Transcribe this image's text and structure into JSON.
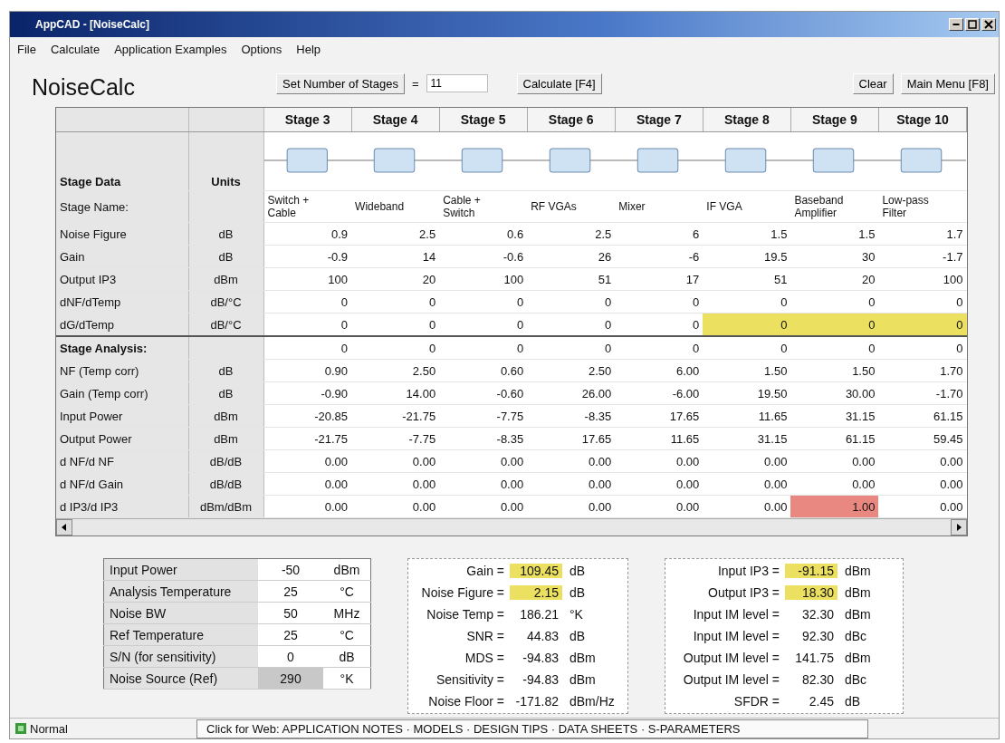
{
  "window": {
    "title": "AppCAD - [NoiseCalc]"
  },
  "menu": [
    "File",
    "Calculate",
    "Application Examples",
    "Options",
    "Help"
  ],
  "app_title": "NoiseCalc",
  "toolbar": {
    "set_stages_button": "Set Number of Stages",
    "equals": "=",
    "stages_value": "11",
    "calculate_button": "Calculate [F4]",
    "clear_button": "Clear",
    "main_menu_button": "Main Menu [F8]"
  },
  "stage_table": {
    "data_heading": "Stage Data",
    "units_heading": "Units",
    "name_label": "Stage Name:",
    "stages": [
      {
        "header": "Stage 3",
        "name": "Switch + Cable"
      },
      {
        "header": "Stage 4",
        "name": "Wideband"
      },
      {
        "header": "Stage 5",
        "name": "Cable + Switch"
      },
      {
        "header": "Stage 6",
        "name": "RF VGAs"
      },
      {
        "header": "Stage 7",
        "name": "Mixer"
      },
      {
        "header": "Stage 8",
        "name": "IF VGA"
      },
      {
        "header": "Stage 9",
        "name": "Baseband Amplifier"
      },
      {
        "header": "Stage 10",
        "name": "Low-pass Filter"
      }
    ],
    "data_rows": [
      {
        "label": "Noise Figure",
        "unit": "dB",
        "cells": [
          {
            "text": "0.9"
          },
          {
            "text": "2.5"
          },
          {
            "text": "0.6"
          },
          {
            "text": "2.5"
          },
          {
            "text": "6"
          },
          {
            "text": "1.5"
          },
          {
            "text": "1.5"
          },
          {
            "text": "1.7"
          }
        ]
      },
      {
        "label": "Gain",
        "unit": "dB",
        "cells": [
          {
            "text": "-0.9"
          },
          {
            "text": "14"
          },
          {
            "text": "-0.6"
          },
          {
            "text": "26"
          },
          {
            "text": "-6"
          },
          {
            "text": "19.5"
          },
          {
            "text": "30"
          },
          {
            "text": "-1.7"
          }
        ]
      },
      {
        "label": "Output IP3",
        "unit": "dBm",
        "cells": [
          {
            "text": "100"
          },
          {
            "text": "20"
          },
          {
            "text": "100"
          },
          {
            "text": "51"
          },
          {
            "text": "17"
          },
          {
            "text": "51"
          },
          {
            "text": "20"
          },
          {
            "text": "100"
          }
        ]
      },
      {
        "label": "dNF/dTemp",
        "unit": "dB/°C",
        "cells": [
          {
            "text": "0"
          },
          {
            "text": "0"
          },
          {
            "text": "0"
          },
          {
            "text": "0"
          },
          {
            "text": "0"
          },
          {
            "text": "0"
          },
          {
            "text": "0"
          },
          {
            "text": "0"
          }
        ]
      },
      {
        "label": "dG/dTemp",
        "unit": "dB/°C",
        "cells": [
          {
            "text": "0"
          },
          {
            "text": "0"
          },
          {
            "text": "0"
          },
          {
            "text": "0"
          },
          {
            "text": "0"
          },
          {
            "text": "0",
            "color": "#ece060"
          },
          {
            "text": "0",
            "color": "#ece060"
          },
          {
            "text": "0",
            "color": "#ece060"
          }
        ]
      }
    ],
    "analysis_heading": "Stage Analysis:",
    "analysis_heading_cells": [
      {
        "text": "0"
      },
      {
        "text": "0"
      },
      {
        "text": "0"
      },
      {
        "text": "0"
      },
      {
        "text": "0"
      },
      {
        "text": "0"
      },
      {
        "text": "0"
      },
      {
        "text": "0"
      }
    ],
    "analysis_rows": [
      {
        "label": "NF (Temp corr)",
        "unit": "dB",
        "cells": [
          {
            "text": "0.90"
          },
          {
            "text": "2.50"
          },
          {
            "text": "0.60"
          },
          {
            "text": "2.50"
          },
          {
            "text": "6.00"
          },
          {
            "text": "1.50"
          },
          {
            "text": "1.50"
          },
          {
            "text": "1.70"
          }
        ]
      },
      {
        "label": "Gain (Temp corr)",
        "unit": "dB",
        "cells": [
          {
            "text": "-0.90"
          },
          {
            "text": "14.00"
          },
          {
            "text": "-0.60"
          },
          {
            "text": "26.00"
          },
          {
            "text": "-6.00"
          },
          {
            "text": "19.50"
          },
          {
            "text": "30.00"
          },
          {
            "text": "-1.70"
          }
        ]
      },
      {
        "label": "Input Power",
        "unit": "dBm",
        "cells": [
          {
            "text": "-20.85"
          },
          {
            "text": "-21.75"
          },
          {
            "text": "-7.75"
          },
          {
            "text": "-8.35"
          },
          {
            "text": "17.65"
          },
          {
            "text": "11.65"
          },
          {
            "text": "31.15"
          },
          {
            "text": "61.15"
          }
        ]
      },
      {
        "label": "Output Power",
        "unit": "dBm",
        "cells": [
          {
            "text": "-21.75"
          },
          {
            "text": "-7.75"
          },
          {
            "text": "-8.35"
          },
          {
            "text": "17.65"
          },
          {
            "text": "11.65"
          },
          {
            "text": "31.15"
          },
          {
            "text": "61.15"
          },
          {
            "text": "59.45"
          }
        ]
      },
      {
        "label": "d NF/d NF",
        "unit": "dB/dB",
        "cells": [
          {
            "text": "0.00"
          },
          {
            "text": "0.00"
          },
          {
            "text": "0.00"
          },
          {
            "text": "0.00"
          },
          {
            "text": "0.00"
          },
          {
            "text": "0.00"
          },
          {
            "text": "0.00"
          },
          {
            "text": "0.00"
          }
        ]
      },
      {
        "label": "d NF/d Gain",
        "unit": "dB/dB",
        "cells": [
          {
            "text": "0.00"
          },
          {
            "text": "0.00"
          },
          {
            "text": "0.00"
          },
          {
            "text": "0.00"
          },
          {
            "text": "0.00"
          },
          {
            "text": "0.00"
          },
          {
            "text": "0.00"
          },
          {
            "text": "0.00"
          }
        ]
      },
      {
        "label": "d IP3/d IP3",
        "unit": "dBm/dBm",
        "cells": [
          {
            "text": "0.00"
          },
          {
            "text": "0.00"
          },
          {
            "text": "0.00"
          },
          {
            "text": "0.00"
          },
          {
            "text": "0.00"
          },
          {
            "text": "0.00"
          },
          {
            "text": "1.00",
            "color": "#e88880"
          },
          {
            "text": "0.00"
          }
        ]
      }
    ]
  },
  "system_inputs": [
    {
      "label": "Input Power",
      "value": "-50",
      "unit": "dBm",
      "shaded": false
    },
    {
      "label": "Analysis Temperature",
      "value": "25",
      "unit": "°C",
      "shaded": false
    },
    {
      "label": "Noise BW",
      "value": "50",
      "unit": "MHz",
      "shaded": false
    },
    {
      "label": "Ref Temperature",
      "value": "25",
      "unit": "°C",
      "shaded": false
    },
    {
      "label": "S/N (for sensitivity)",
      "value": "0",
      "unit": "dB",
      "shaded": false
    },
    {
      "label": "Noise Source (Ref)",
      "value": "290",
      "unit": "°K",
      "shaded": true
    }
  ],
  "noise_results": [
    {
      "label": "Gain =",
      "value": "109.45",
      "unit": "dB",
      "highlighted": true
    },
    {
      "label": "Noise Figure =",
      "value": "2.15",
      "unit": "dB",
      "highlighted": true
    },
    {
      "label": "Noise Temp =",
      "value": "186.21",
      "unit": "°K",
      "highlighted": false
    },
    {
      "label": "SNR =",
      "value": "44.83",
      "unit": "dB",
      "highlighted": false
    },
    {
      "label": "MDS =",
      "value": "-94.83",
      "unit": "dBm",
      "highlighted": false
    },
    {
      "label": "Sensitivity =",
      "value": "-94.83",
      "unit": "dBm",
      "highlighted": false
    },
    {
      "label": "Noise Floor =",
      "value": "-171.82",
      "unit": "dBm/Hz",
      "highlighted": false
    }
  ],
  "ip3_results": [
    {
      "label": "Input IP3 =",
      "value": "-91.15",
      "unit": "dBm",
      "highlighted": true
    },
    {
      "label": "Output IP3 =",
      "value": "18.30",
      "unit": "dBm",
      "highlighted": true
    },
    {
      "label": "Input IM level =",
      "value": "32.30",
      "unit": "dBm",
      "highlighted": false
    },
    {
      "label": "Input IM level =",
      "value": "92.30",
      "unit": "dBc",
      "highlighted": false
    },
    {
      "label": "Output IM level =",
      "value": "141.75",
      "unit": "dBm",
      "highlighted": false
    },
    {
      "label": "Output IM level =",
      "value": "82.30",
      "unit": "dBc",
      "highlighted": false
    },
    {
      "label": "SFDR =",
      "value": "2.45",
      "unit": "dB",
      "highlighted": false
    }
  ],
  "status_bar": {
    "mode": "Normal",
    "web_links": "Click for Web: APPLICATION NOTES · MODELS · DESIGN TIPS · DATA SHEETS · S-PARAMETERS"
  }
}
